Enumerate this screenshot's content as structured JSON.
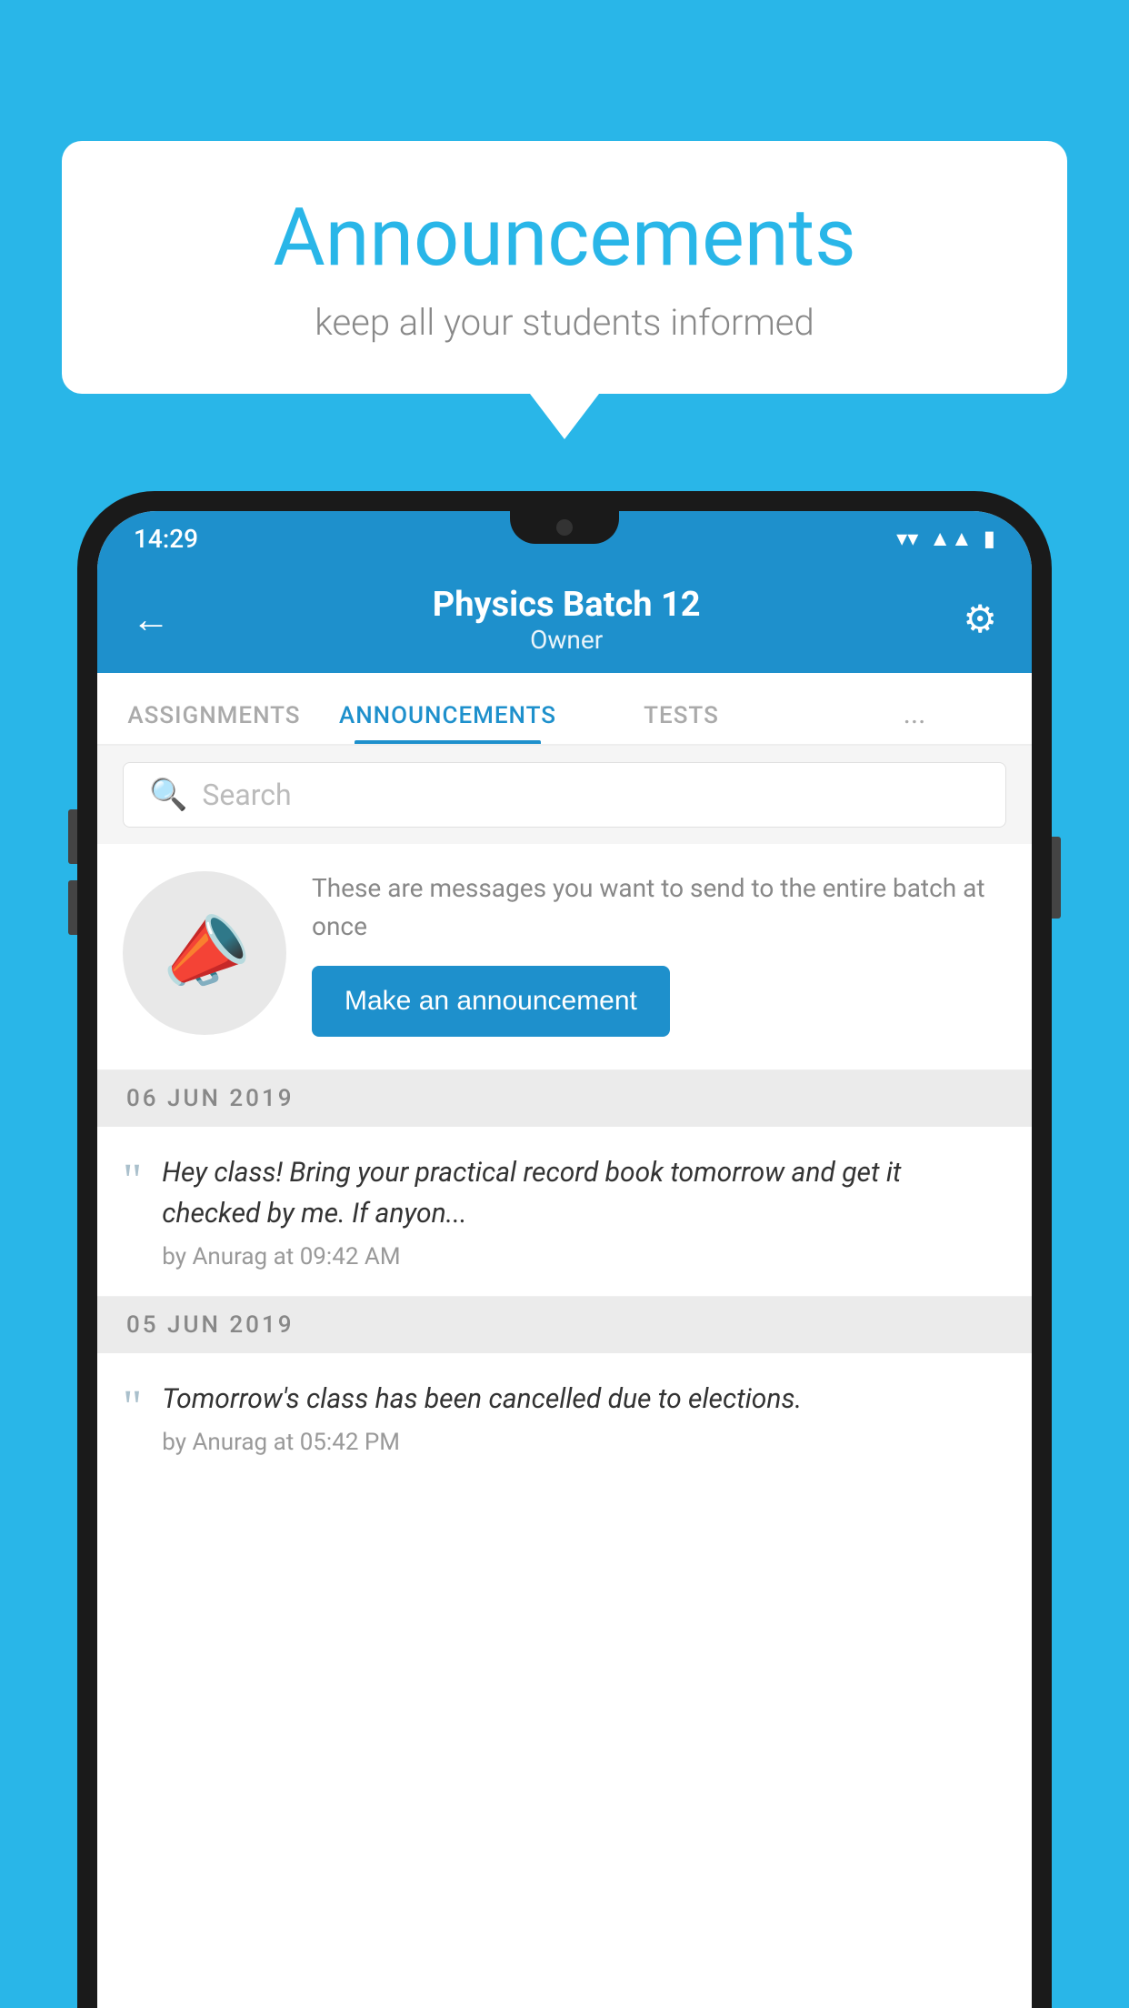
{
  "background_color": "#29b6e8",
  "speech_bubble": {
    "title": "Announcements",
    "subtitle": "keep all your students informed"
  },
  "status_bar": {
    "time": "14:29",
    "icons": [
      "wifi",
      "signal",
      "battery"
    ]
  },
  "app_header": {
    "title": "Physics Batch 12",
    "subtitle": "Owner",
    "back_label": "←",
    "settings_label": "⚙"
  },
  "tabs": [
    {
      "label": "ASSIGNMENTS",
      "active": false
    },
    {
      "label": "ANNOUNCEMENTS",
      "active": true
    },
    {
      "label": "TESTS",
      "active": false
    },
    {
      "label": "...",
      "active": false
    }
  ],
  "search": {
    "placeholder": "Search"
  },
  "promo": {
    "description": "These are messages you want to send to the entire batch at once",
    "button_label": "Make an announcement"
  },
  "announcements": [
    {
      "date": "06  JUN  2019",
      "message": "Hey class! Bring your practical record book tomorrow and get it checked by me. If anyon...",
      "meta": "by Anurag at 09:42 AM"
    },
    {
      "date": "05  JUN  2019",
      "message": "Tomorrow's class has been cancelled due to elections.",
      "meta": "by Anurag at 05:42 PM"
    }
  ]
}
